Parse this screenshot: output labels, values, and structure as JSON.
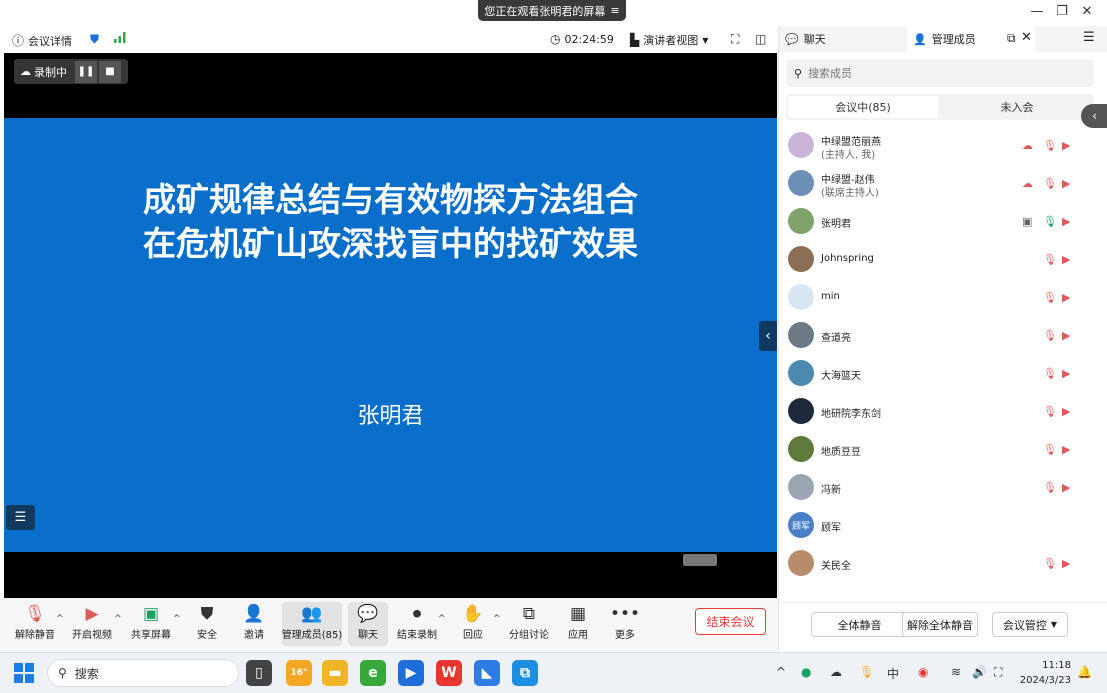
{
  "title_bar": {
    "share_notice": "您正在观看张明君的屏幕"
  },
  "top_toolbar": {
    "meeting_details": "会议详情",
    "timer": "02:24:59",
    "view_mode": "演讲者视图"
  },
  "recording": {
    "label": "录制中"
  },
  "slide": {
    "title_line1": "成矿规律总结与有效物探方法组合",
    "title_line2": "在危机矿山攻深找盲中的找矿效果",
    "author": "张明君"
  },
  "bottom_toolbar": {
    "items": [
      {
        "label": "解除静音",
        "icon": "mic-muted-icon"
      },
      {
        "label": "开启视频",
        "icon": "video-off-icon"
      },
      {
        "label": "共享屏幕",
        "icon": "share-screen-icon"
      },
      {
        "label": "安全",
        "icon": "shield-icon"
      },
      {
        "label": "邀请",
        "icon": "invite-icon"
      },
      {
        "label": "管理成员(85)",
        "icon": "members-icon"
      },
      {
        "label": "聊天",
        "icon": "chat-icon"
      },
      {
        "label": "结束录制",
        "icon": "stop-record-icon"
      },
      {
        "label": "回应",
        "icon": "reaction-icon"
      },
      {
        "label": "分组讨论",
        "icon": "breakout-icon"
      },
      {
        "label": "应用",
        "icon": "apps-icon"
      },
      {
        "label": "更多",
        "icon": "more-icon"
      }
    ],
    "end_meeting": "结束会议"
  },
  "panel": {
    "tab_chat": "聊天",
    "tab_members": "管理成员",
    "search_placeholder": "搜索成员",
    "seg_in_meeting": "会议中(85)",
    "seg_not_joined": "未入会",
    "members": [
      {
        "name": "中绿盟范丽燕",
        "role": "(主持人, 我)",
        "avatar_color": "#c9b4d8"
      },
      {
        "name": "中绿盟-赵伟",
        "role": "(联席主持人)",
        "avatar_color": "#6b8fb5"
      },
      {
        "name": "张明君",
        "role": "",
        "avatar_color": "#7fa36a"
      },
      {
        "name": "Johnspring",
        "role": "",
        "avatar_color": "#8a6f55"
      },
      {
        "name": "min",
        "role": "",
        "avatar_color": "#d6e6f2"
      },
      {
        "name": "查道亮",
        "role": "",
        "avatar_color": "#6c7a86"
      },
      {
        "name": "大海篮天",
        "role": "",
        "avatar_color": "#4c8ab0"
      },
      {
        "name": "地研院李东剑",
        "role": "",
        "avatar_color": "#1e2a3a"
      },
      {
        "name": "地质豆豆",
        "role": "",
        "avatar_color": "#5e7a3c"
      },
      {
        "name": "冯新",
        "role": "",
        "avatar_color": "#9aa7b3"
      },
      {
        "name": "顾军",
        "role": "",
        "avatar_color": "#4a7fc8",
        "avatar_text": "顾军"
      },
      {
        "name": "关民全",
        "role": "",
        "avatar_color": "#b88c6a"
      }
    ],
    "mute_all": "全体静音",
    "unmute_all": "解除全体静音",
    "meeting_control": "会议管控"
  },
  "taskbar": {
    "search_label": "搜索",
    "weather": "16°",
    "time": "11:18",
    "date": "2024/3/23"
  },
  "colors": {
    "slide_bg": "#0a6ecb",
    "end_red": "#e63b3b",
    "muted_red": "#e05a5a"
  }
}
